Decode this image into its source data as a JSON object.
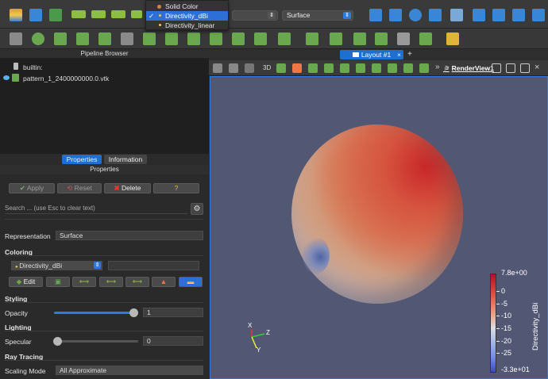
{
  "coloring_popup": {
    "items": [
      {
        "label": "Solid Color",
        "selected": false
      },
      {
        "label": "Directivity_dBi",
        "selected": true
      },
      {
        "label": "Directivity_linear",
        "selected": false
      }
    ],
    "check": "✓"
  },
  "toolbar": {
    "representation_value": "Surface"
  },
  "pipeline_browser": {
    "title": "Pipeline Browser",
    "items": [
      {
        "label": "builtin:"
      },
      {
        "label": "pattern_1_2400000000.0.vtk"
      }
    ]
  },
  "panel_tabs": [
    {
      "label": "Properties",
      "active": true
    },
    {
      "label": "Information",
      "active": false
    }
  ],
  "properties": {
    "title": "Properties",
    "apply_label": "Apply",
    "reset_label": "Reset",
    "delete_label": "Delete",
    "help_label": "?",
    "search_placeholder": "Search ... (use Esc to clear text)",
    "representation_label": "Representation",
    "representation_value": "Surface",
    "coloring_header": "Coloring",
    "coloring_value": "Directivity_dBi",
    "edit_label": "Edit",
    "styling_header": "Styling",
    "opacity_label": "Opacity",
    "opacity_value": "1",
    "lighting_header": "Lighting",
    "specular_label": "Specular",
    "specular_value": "0",
    "ray_tracing_header": "Ray Tracing",
    "scaling_mode_label": "Scaling Mode",
    "scaling_mode_value": "All Approximate"
  },
  "view": {
    "layout_tab": "Layout #1",
    "add_tab": "+",
    "view_label": "RenderView1",
    "mode_3d": "3D"
  },
  "colorbar": {
    "title": "Directivity_dBi",
    "max_label": "7.8e+00",
    "min_label": "-3.3e+01",
    "ticks": [
      "0",
      "-5",
      "-10",
      "-15",
      "-20",
      "-25"
    ]
  },
  "axes": {
    "x": "X",
    "y": "Y",
    "z": "Z"
  },
  "colors": {
    "accent": "#1f6fd1",
    "background_view": "#525874"
  }
}
